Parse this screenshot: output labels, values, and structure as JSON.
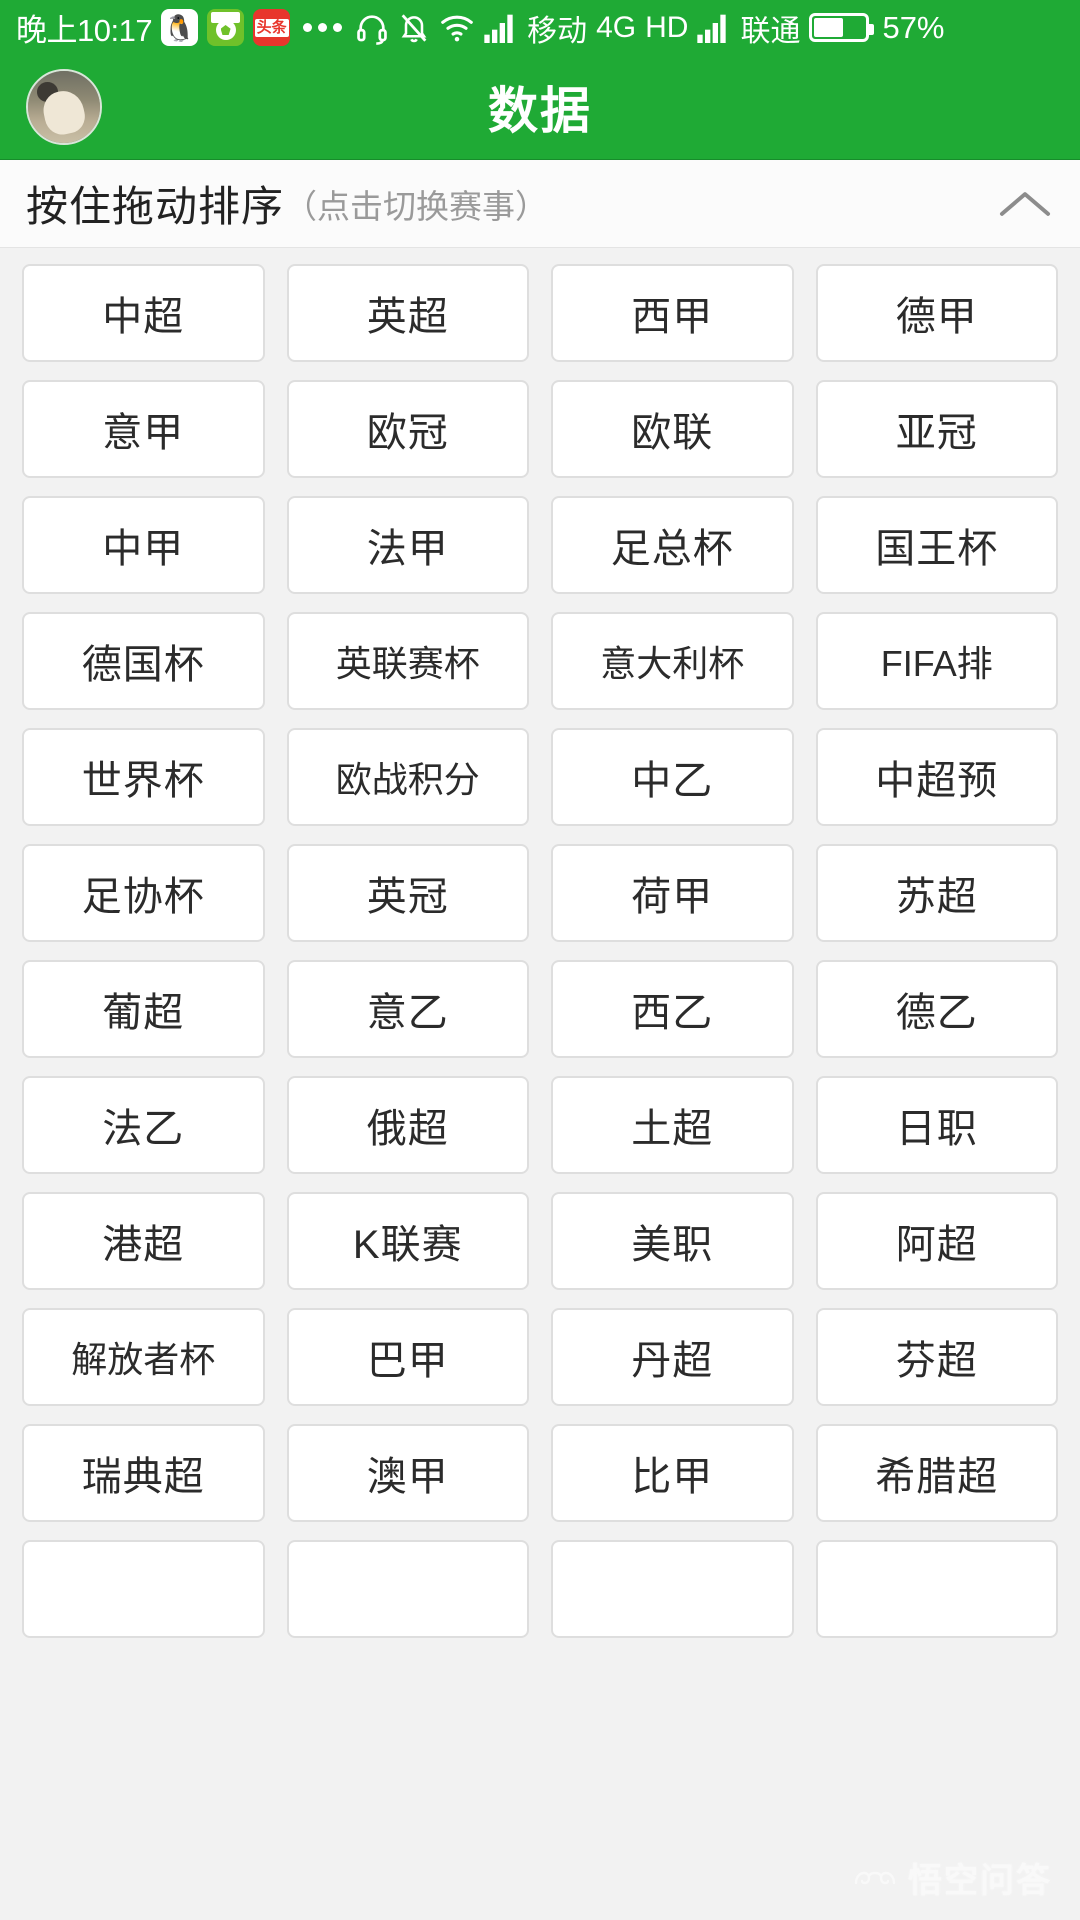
{
  "statusbar": {
    "time": "晚上10:17",
    "app_icons": [
      "qq-icon",
      "football-live-icon",
      "toutiao-icon"
    ],
    "overflow": "more-icon",
    "headset": "headset-icon",
    "silent": "bell-muted-icon",
    "wifi": "wifi-icon",
    "signal1": "signal-bars-icon",
    "carrier1": "移动",
    "network": "4G",
    "hd": "HD",
    "signal2": "signal-bars-icon",
    "carrier2": "联通",
    "battery_icon": "battery-icon",
    "battery_percent": "57%",
    "battery_level": 57
  },
  "header": {
    "avatar": "user-avatar",
    "title": "数据"
  },
  "section": {
    "main_label": "按住拖动排序",
    "sub_label": "（点击切换赛事）",
    "collapse_icon": "chevron-up-icon"
  },
  "grid": {
    "columns": 4,
    "items": [
      "中超",
      "英超",
      "西甲",
      "德甲",
      "意甲",
      "欧冠",
      "欧联",
      "亚冠",
      "中甲",
      "法甲",
      "足总杯",
      "国王杯",
      "德国杯",
      "英联赛杯",
      "意大利杯",
      "FIFA排",
      "世界杯",
      "欧战积分",
      "中乙",
      "中超预",
      "足协杯",
      "英冠",
      "荷甲",
      "苏超",
      "葡超",
      "意乙",
      "西乙",
      "德乙",
      "法乙",
      "俄超",
      "土超",
      "日职",
      "港超",
      "K联赛",
      "美职",
      "阿超",
      "解放者杯",
      "巴甲",
      "丹超",
      "芬超",
      "瑞典超",
      "澳甲",
      "比甲",
      "希腊超",
      "",
      "",
      "",
      ""
    ]
  },
  "watermark": {
    "text": "悟空问答",
    "logo": "wukong-logo-icon"
  },
  "colors": {
    "brand_green": "#1faa35",
    "page_bg": "#f2f2f2",
    "cell_bg": "#ffffff",
    "cell_border": "#dedede",
    "text_primary": "#2b2b2b",
    "text_muted": "#9a9a9a"
  }
}
